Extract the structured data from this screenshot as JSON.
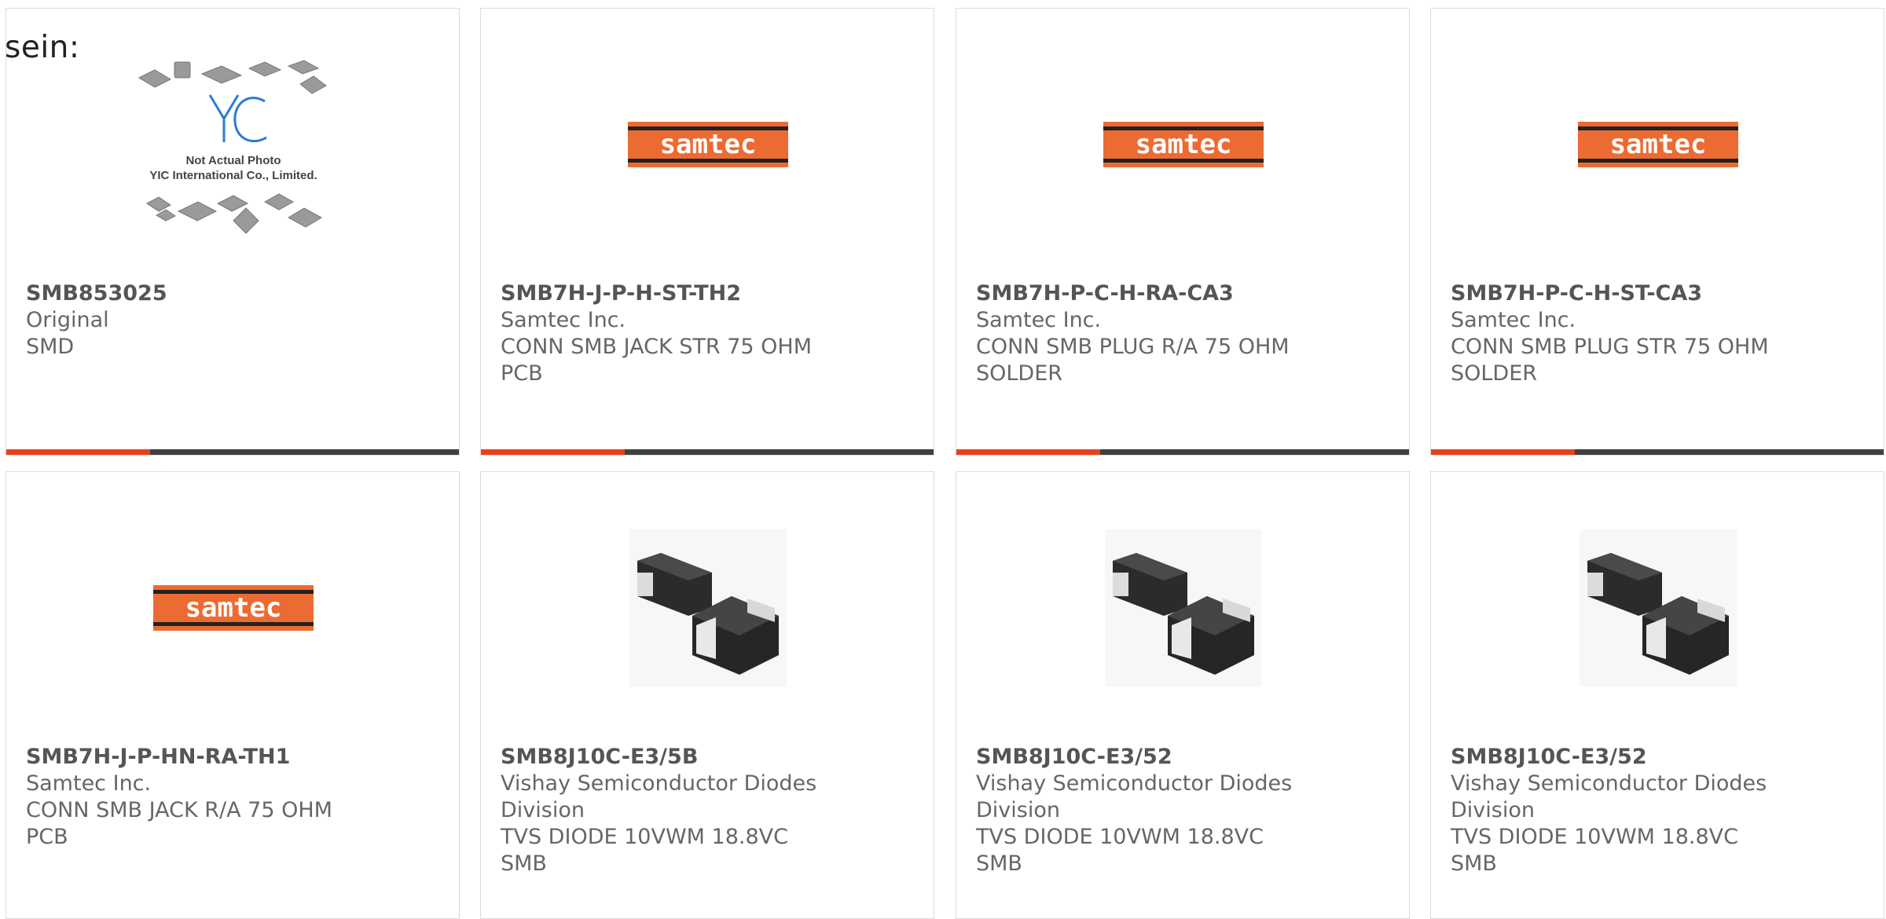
{
  "lead_text": "sein:",
  "placeholder": {
    "line1": "Not Actual Photo",
    "line2": "YIC International Co., Limited.",
    "logo": "YIC"
  },
  "brand_logo_text": "samtec",
  "colors": {
    "accent": "#e8401c",
    "bar": "#404040",
    "samtec_orange": "#ec6b32",
    "text": "#666666"
  },
  "products": [
    {
      "part": "SMB853025",
      "lines": [
        "Original",
        "SMD"
      ],
      "image": "placeholder"
    },
    {
      "part": "SMB7H-J-P-H-ST-TH2",
      "lines": [
        "Samtec Inc.",
        "CONN SMB JACK STR 75 OHM",
        "PCB"
      ],
      "image": "samtec-logo"
    },
    {
      "part": "SMB7H-P-C-H-RA-CA3",
      "lines": [
        "Samtec Inc.",
        "CONN SMB PLUG R/A 75 OHM",
        "SOLDER"
      ],
      "image": "samtec-logo"
    },
    {
      "part": "SMB7H-P-C-H-ST-CA3",
      "lines": [
        "Samtec Inc.",
        "CONN SMB PLUG STR 75 OHM",
        "SOLDER"
      ],
      "image": "samtec-logo"
    },
    {
      "part": "SMB7H-J-P-HN-RA-TH1",
      "lines": [
        "Samtec Inc.",
        "CONN SMB JACK R/A 75 OHM",
        "PCB"
      ],
      "image": "samtec-logo"
    },
    {
      "part": "SMB8J10C-E3/5B",
      "lines": [
        "Vishay Semiconductor Diodes",
        "Division",
        "TVS DIODE 10VWM 18.8VC SMB"
      ],
      "image": "diode-photo"
    },
    {
      "part": "SMB8J10C-E3/52",
      "lines": [
        "Vishay Semiconductor Diodes",
        "Division",
        "TVS DIODE 10VWM 18.8VC SMB"
      ],
      "image": "diode-photo"
    },
    {
      "part": "SMB8J10C-E3/52",
      "lines": [
        "Vishay Semiconductor Diodes",
        "Division",
        "TVS DIODE 10VWM 18.8VC SMB"
      ],
      "image": "diode-photo"
    }
  ]
}
